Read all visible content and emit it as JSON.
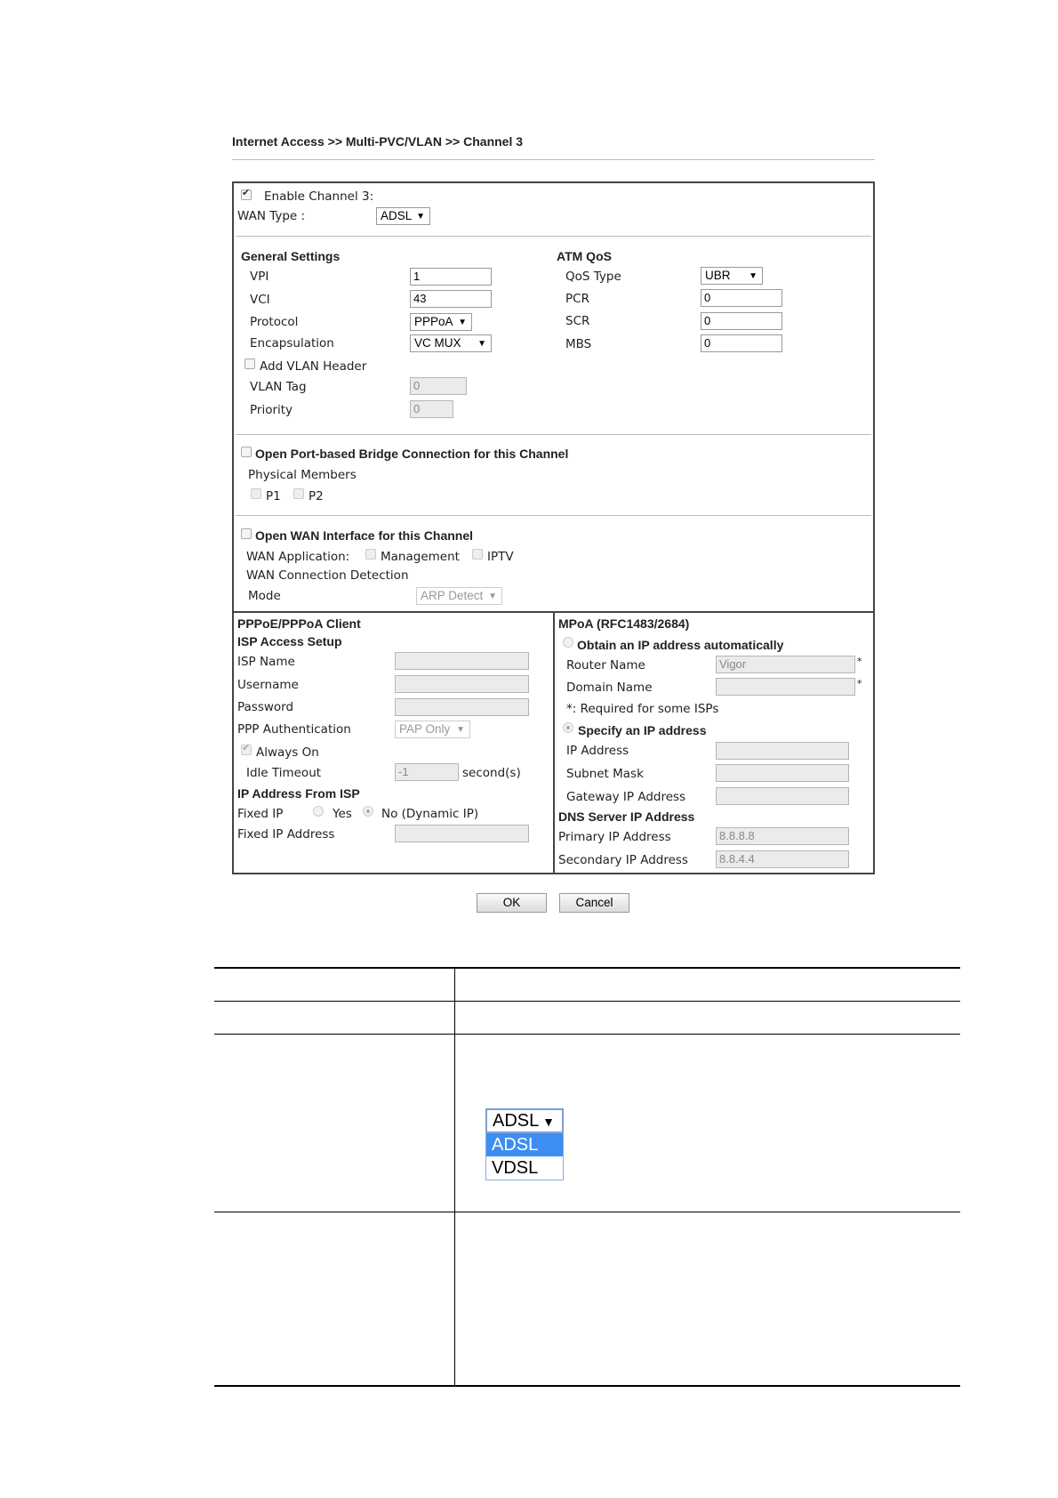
{
  "breadcrumb": "Internet Access >> Multi-PVC/VLAN >> Channel 3",
  "enable_channel": {
    "label": "Enable Channel 3:",
    "checked": true
  },
  "wan_type": {
    "label": "WAN Type  :",
    "value": "ADSL"
  },
  "general": {
    "heading": "General Settings",
    "vpi_label": "VPI",
    "vpi": "1",
    "vci_label": "VCI",
    "vci": "43",
    "protocol_label": "Protocol",
    "protocol": "PPPoA",
    "encap_label": "Encapsulation",
    "encap": "VC MUX",
    "add_vlan_label": "Add VLAN Header",
    "vlan_tag_label": "VLAN Tag",
    "vlan_tag": "0",
    "priority_label": "Priority",
    "priority": "0"
  },
  "atm": {
    "heading": "ATM QoS",
    "qos_label": "QoS Type",
    "qos": "UBR",
    "pcr_label": "PCR",
    "pcr": "0",
    "scr_label": "SCR",
    "scr": "0",
    "mbs_label": "MBS",
    "mbs": "0"
  },
  "bridge": {
    "label": "Open Port-based Bridge Connection for this Channel",
    "members_label": "Physical Members",
    "p1": "P1",
    "p2": "P2"
  },
  "wan_iface": {
    "label": "Open WAN Interface for this Channel",
    "app_label": "WAN Application:",
    "mgmt": "Management",
    "iptv": "IPTV",
    "detect_label": "WAN Connection Detection",
    "mode_label": "Mode",
    "mode": "ARP Detect"
  },
  "pppoe": {
    "heading": "PPPoE/PPPoA Client",
    "isp_setup": "ISP Access Setup",
    "isp_name": "ISP Name",
    "username": "Username",
    "password": "Password",
    "auth_label": "PPP Authentication",
    "auth": "PAP Only",
    "always_on": "Always On",
    "idle_label": "Idle Timeout",
    "idle": "-1",
    "idle_unit": "second(s)",
    "ip_from_isp": "IP Address From ISP",
    "fixed_ip": "Fixed IP",
    "yes": "Yes",
    "no": "No (Dynamic IP)",
    "fixed_ip_addr": "Fixed IP Address"
  },
  "mpoa": {
    "heading": "MPoA (RFC1483/2684)",
    "obtain": "Obtain an IP address automatically",
    "router_name_label": "Router Name",
    "router_name": "Vigor",
    "domain_label": "Domain Name",
    "star": "*",
    "note": "*: Required for some ISPs",
    "specify": "Specify an IP address",
    "ip_label": "IP Address",
    "mask_label": "Subnet Mask",
    "gw_label": "Gateway IP Address",
    "dns_heading": "DNS Server IP Address",
    "primary_label": "Primary IP Address",
    "primary": "8.8.8.8",
    "secondary_label": "Secondary IP Address",
    "secondary": "8.8.4.4"
  },
  "buttons": {
    "ok": "OK",
    "cancel": "Cancel"
  },
  "dropdown": {
    "selected": "ADSL",
    "options": [
      "ADSL",
      "VDSL"
    ]
  },
  "icons": {
    "arrow": "dropdown-arrow-icon",
    "check": "checkmark-icon"
  }
}
